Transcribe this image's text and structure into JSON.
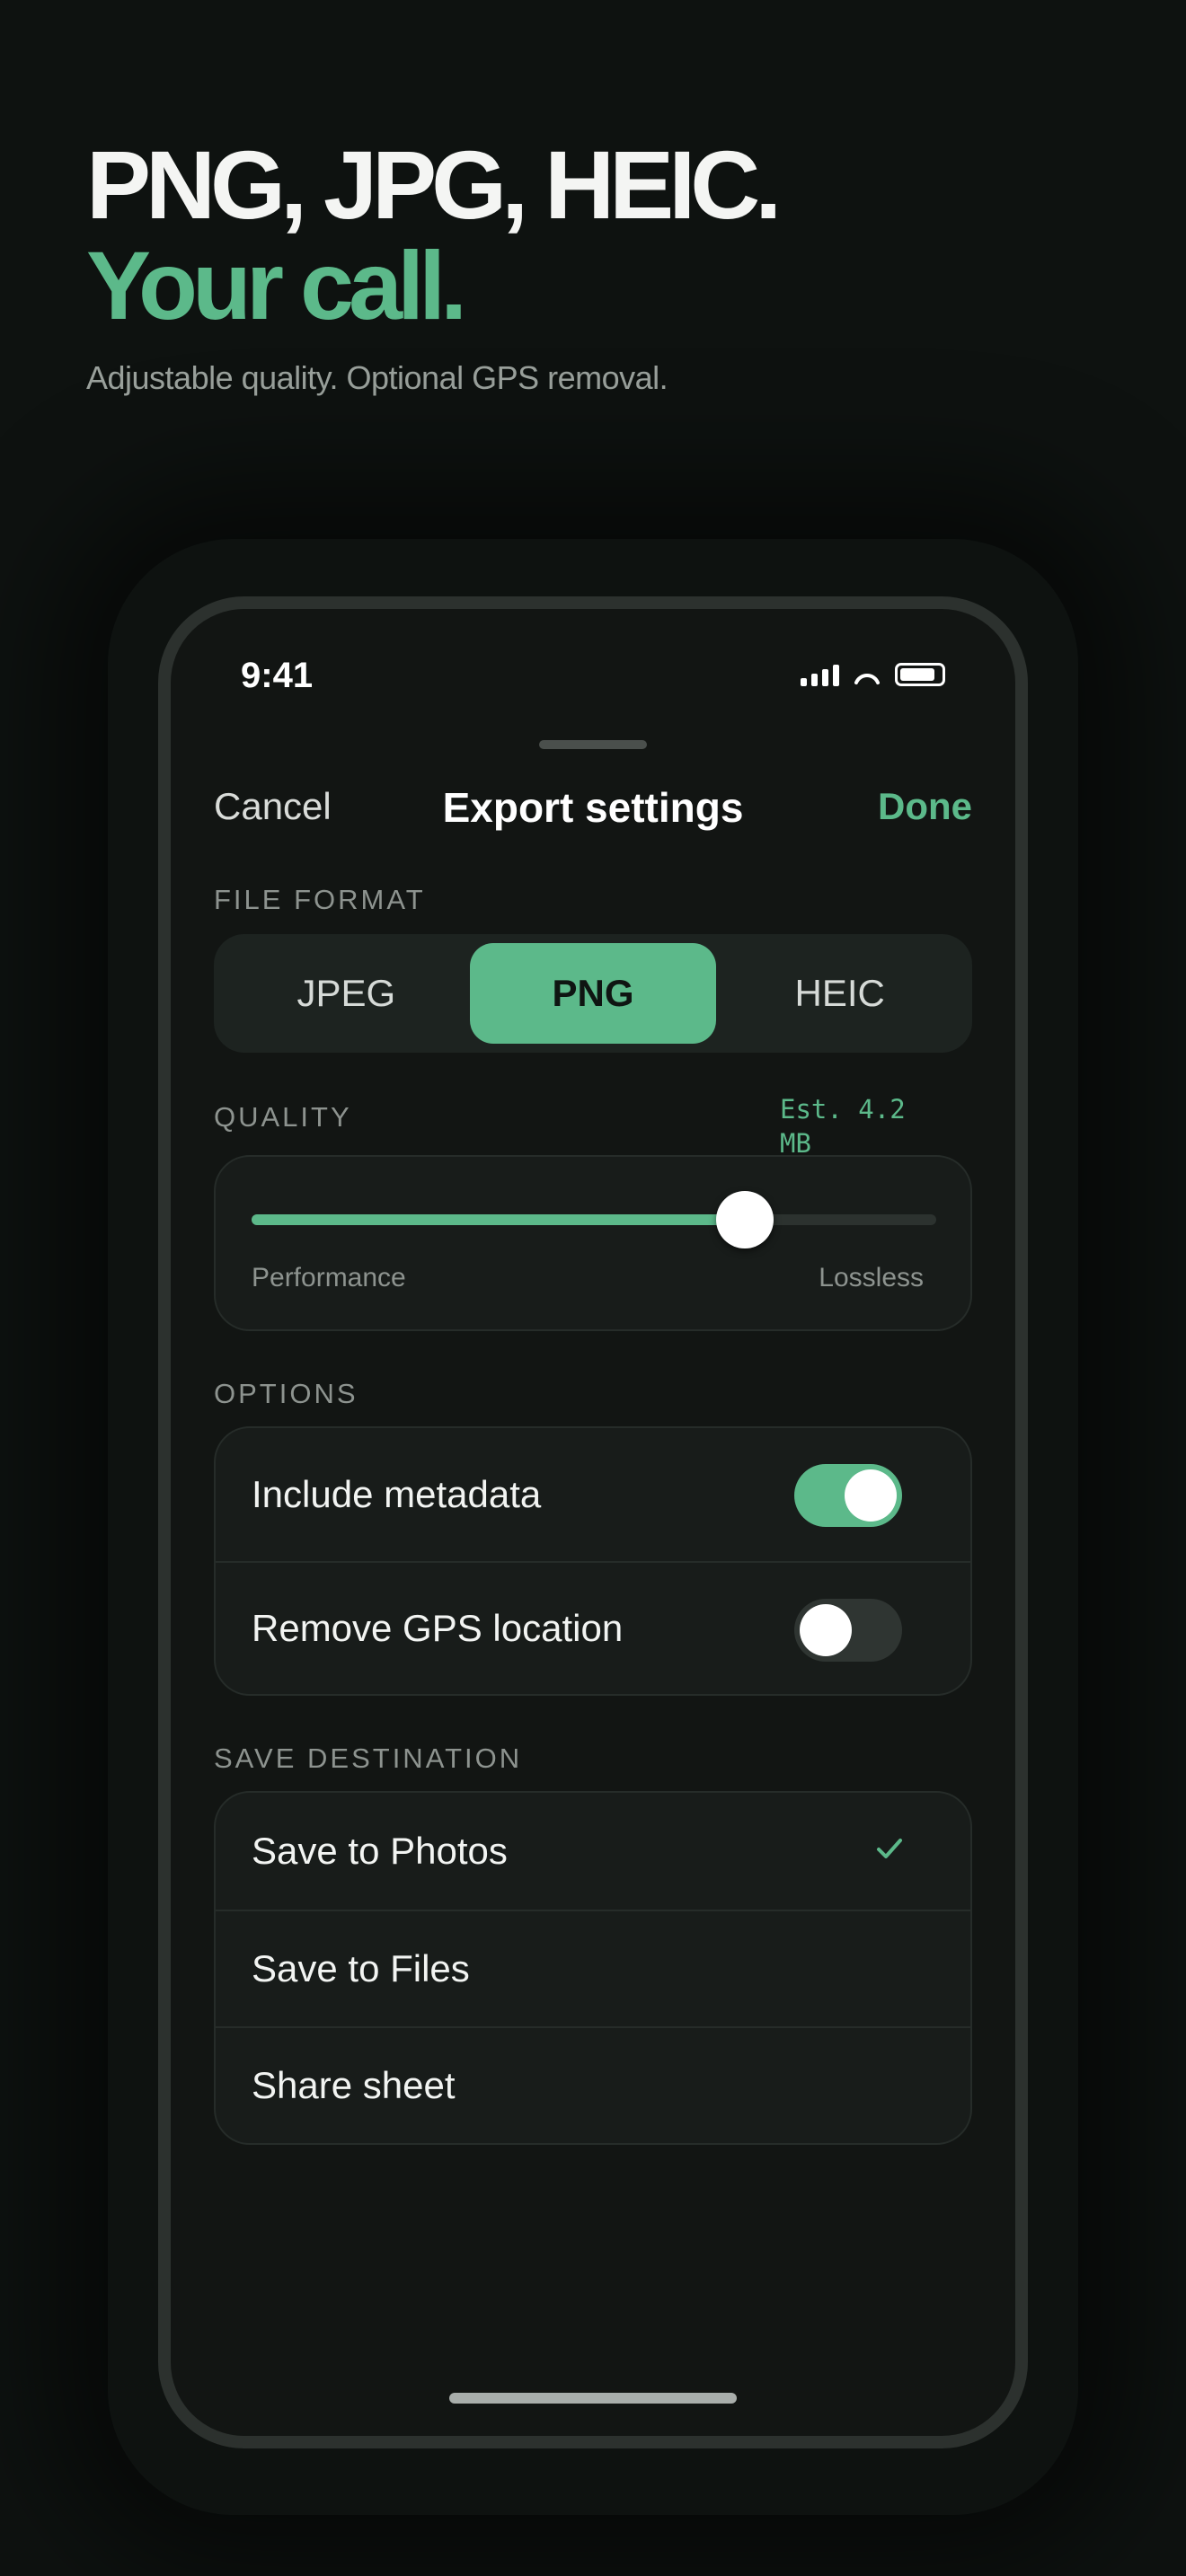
{
  "headline": {
    "line1": "PNG, JPG, HEIC.",
    "line2": "Your call.",
    "subtitle": "Adjustable quality. Optional GPS removal."
  },
  "status_bar": {
    "time": "9:41",
    "icons": [
      "cellular-signal-icon",
      "wifi-icon",
      "battery-icon"
    ]
  },
  "nav": {
    "cancel_label": "Cancel",
    "title": "Export settings",
    "done_label": "Done"
  },
  "file_format": {
    "label": "FILE FORMAT",
    "options": [
      "JPEG",
      "PNG",
      "HEIC"
    ],
    "selected": "PNG"
  },
  "quality": {
    "label": "QUALITY",
    "estimate": "Est. 4.2 MB",
    "slider_value_fraction": 0.72,
    "min_label": "Performance",
    "max_label": "Lossless"
  },
  "options": {
    "label": "OPTIONS",
    "items": [
      {
        "label": "Include metadata",
        "enabled": true
      },
      {
        "label": "Remove GPS location",
        "enabled": false
      }
    ]
  },
  "save_destination": {
    "label": "SAVE DESTINATION",
    "items": [
      {
        "label": "Save to Photos",
        "selected": true
      },
      {
        "label": "Save to Files",
        "selected": false
      },
      {
        "label": "Share sheet",
        "selected": false
      }
    ]
  },
  "colors": {
    "accent": "#5cb98a",
    "background": "#0e1210",
    "card": "#181c1a"
  }
}
